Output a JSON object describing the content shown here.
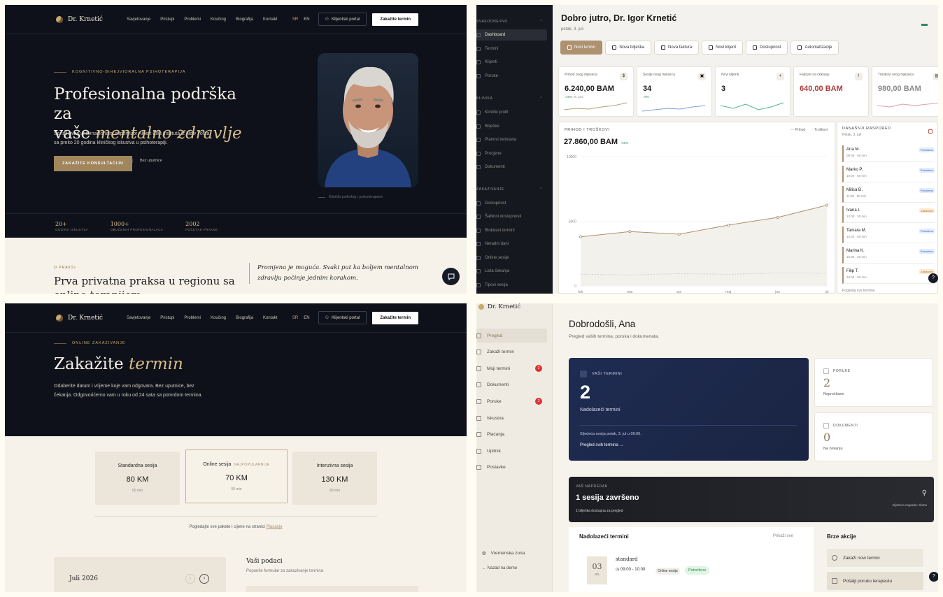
{
  "landing": {
    "brand": "Dr. Krnetić",
    "nav": [
      "Savjetovanje",
      "Pristupi",
      "Problemi",
      "Koučıng",
      "Biografija",
      "Kontakt"
    ],
    "lang": [
      "SR",
      "EN"
    ],
    "portal_btn": "Klijentski portal",
    "book_btn": "Zakažite termin",
    "eyebrow": "KOGNITIVNO-BIHEJVIORALNA PSIHOTERAPIJA",
    "title_1": "Profesionalna podrška za",
    "title_2a": "vaše ",
    "title_2b": "mentalno zdravlje",
    "text": "Sertifikovani internacionalni supervizor Albert Ellis instituta iz New Yorka sa preko 20 godina kliničkog iskustva u psihoterapiji.",
    "cta": "ZAKAŽITE KONSULTACIJU",
    "cta_link": "Bez uputnice",
    "caption": "Klinički psiholog i psihoterapeut",
    "stats": [
      {
        "value": "20+",
        "label": "GODINA ISKUSTVA"
      },
      {
        "value": "1000+",
        "label": "OBUČENIH PROFESIONALACA"
      },
      {
        "value": "2002",
        "label": "POČETAK PRAKSE"
      }
    ],
    "about_eyebrow": "O PRAKSI",
    "about_title": "Prva privatna praksa u regionu sa online terapijom",
    "quote": "Promjena je moguća. Svaki put ka boljem mentalnom zdravlju počinje jednim korakom."
  },
  "dashboard": {
    "greeting": "Dobro jutro, Dr. Igor Krnetić",
    "date": "petak, 3. juli",
    "sections": [
      {
        "title": "SVAKODNEVNO",
        "items": [
          "Dashboard",
          "Termini",
          "Klijenti",
          "Poruke"
        ]
      },
      {
        "title": "KLINIKA",
        "items": [
          "Klinički profil",
          "Bilješke",
          "Planovi tretmana",
          "Procjene",
          "Dokumenti"
        ]
      },
      {
        "title": "ZAKAZIVANJE",
        "items": [
          "Dostupnost",
          "Šabloni dostupnosti",
          "Blokirani termini",
          "Neradni dani",
          "Online sesije",
          "Lista čekanja",
          "Tipovi sesija"
        ]
      }
    ],
    "actions": [
      "Novi termin",
      "Nova bilješka",
      "Nova faktura",
      "Novi klijent",
      "Dostupnost",
      "Automatizacije"
    ],
    "kpis": [
      {
        "title": "Prihod ovog mjeseca",
        "value": "6.240,00 BAM",
        "delta": "↑20%",
        "delta_note": "vs. juni",
        "color": "#1a1a1a",
        "spark": "#b9a07a",
        "icon": "$"
      },
      {
        "title": "Sesije ovog mjeseca",
        "value": "34",
        "delta": "↑8%",
        "delta_note": "",
        "color": "#1a1a1a",
        "spark": "#7ea0d8",
        "icon": "▣"
      },
      {
        "title": "Novi klijenti",
        "value": "3",
        "delta": "",
        "delta_note": "",
        "color": "#1a1a1a",
        "spark": "#4fb58a",
        "icon": "+"
      },
      {
        "title": "Fakture na čekanju",
        "value": "640,00 BAM",
        "delta": "",
        "delta_note": "",
        "color": "#b23a3a",
        "spark": "",
        "icon": "!"
      },
      {
        "title": "Troškovi ovog mjeseca",
        "value": "980,00 BAM",
        "delta": "",
        "delta_note": "",
        "color": "#8a8a8a",
        "spark": "#e0a0a0",
        "icon": "▤"
      }
    ],
    "chart_title": "PRIHOD I TROŠKOVI",
    "chart_total": "27.860,00 BAM",
    "chart_delta": "↑20%",
    "legend": [
      "Prihod",
      "Troškovi"
    ],
    "schedule_title": "DANAŠNJI RASPORED",
    "schedule_sub": "Petak, 3. juli",
    "schedule": [
      {
        "name": "Ana M.",
        "time": "09:00 · 60 min",
        "status": "Potvrđeno",
        "warn": false
      },
      {
        "name": "Marko P.",
        "time": "10:00 · 60 min",
        "status": "Potvrđeno",
        "warn": false
      },
      {
        "name": "Milica Đ.",
        "time": "11:00 · 90 min",
        "status": "Potvrđeno",
        "warn": false
      },
      {
        "name": "Ivana I.",
        "time": "13:00 · 30 min",
        "status": "Zakazano",
        "warn": true
      },
      {
        "name": "Tamara M.",
        "time": "14:00 · 60 min",
        "status": "Potvrđeno",
        "warn": false
      },
      {
        "name": "Marina K.",
        "time": "15:00 · 20 min",
        "status": "Potvrđeno",
        "warn": false
      },
      {
        "name": "Filip T.",
        "time": "16:00 · 60 min",
        "status": "Zakazano",
        "warn": true
      }
    ],
    "schedule_footer": "Pogledaj sve termine"
  },
  "chart_data": {
    "type": "line",
    "title": "PRIHOD I TROŠKOVI",
    "categories": [
      "feb",
      "mar",
      "apr",
      "maj",
      "jun",
      "jul"
    ],
    "series": [
      {
        "name": "Prihod",
        "values": [
          3800,
          4200,
          4000,
          4700,
          5300,
          6240
        ]
      },
      {
        "name": "Troškovi",
        "values": [
          900,
          850,
          950,
          900,
          1000,
          980
        ]
      }
    ],
    "yticks": [
      0,
      5000,
      10000
    ],
    "ylim": [
      0,
      10000
    ]
  },
  "booking": {
    "eyebrow": "ONLINE ZAKAZIVANJE",
    "title_a": "Zakažite ",
    "title_b": "termin",
    "text": "Odaberite datum i vrijeme koje vam odgovara. Bez uputnice, bez čekanja. Odgovorićemo vam u roku od 24 sata sa potvrdom termina.",
    "packages": [
      {
        "name": "Standardna sesija",
        "tag": "",
        "price": "80 KM",
        "dur": "50 min"
      },
      {
        "name": "Online sesija",
        "tag": "NAJPOPULARNIJE",
        "price": "70 KM",
        "dur": "50 min"
      },
      {
        "name": "Intenzivna sesija",
        "tag": "",
        "price": "130 KM",
        "dur": "90 min"
      }
    ],
    "note": "Pogledajte sve pakete i cijene na stranici ",
    "note_link": "Plaćanje",
    "month": "Juli 2026",
    "form_title": "Vaši podaci",
    "form_sub": "Popunite formular za zakazivanje termina"
  },
  "portal": {
    "brand": "Dr. Krnetić",
    "nav": [
      {
        "label": "Pregled",
        "count": ""
      },
      {
        "label": "Zakaži termin",
        "count": ""
      },
      {
        "label": "Moji termini",
        "count": "2"
      },
      {
        "label": "Dokumenti",
        "count": ""
      },
      {
        "label": "Poruke",
        "count": "2"
      },
      {
        "label": "Iskustva",
        "count": ""
      },
      {
        "label": "Plaćanja",
        "count": ""
      },
      {
        "label": "Upitnik",
        "count": ""
      },
      {
        "label": "Postavke",
        "count": ""
      }
    ],
    "timezone": "Vremenska zona",
    "back": "← Nazad na demo",
    "welcome": "Dobrodošli, Ana",
    "welcome_sub": "Pregled vaših termina, poruka i dokumenata.",
    "appts_label": "VAŠI TERMINI",
    "appts_count": "2",
    "appts_sub": "Nadolazeći termini",
    "next_session": "Sljedeća sesija petak, 3. jul u 09:00.",
    "all_link": "Pregled svih termina →",
    "messages_label": "PORUKE",
    "messages_count": "2",
    "messages_sub": "Nepročitano",
    "docs_label": "DOKUMENTI",
    "docs_count": "0",
    "docs_sub": "Na čekanju",
    "progress_label": "VAŠ NAPREDAK",
    "progress_title": "1 sesija završeno",
    "progress_sub": "1 bilješka dostupna za pregled",
    "progress_right": "Sljedeća nagrada: zlatna",
    "upcoming_title": "Nadolazeći termini",
    "show_all": "Prikaži sve",
    "appt_day": "03",
    "appt_month": "JUL",
    "appt_type": "standard",
    "appt_time": "09:00 - 10:00",
    "appt_mode": "Online sesija",
    "appt_status": "Potvrđeno",
    "quick_title": "Brze akcije",
    "quick": [
      "Zakaži novi termin",
      "Pošalji poruku terapeutu"
    ]
  }
}
